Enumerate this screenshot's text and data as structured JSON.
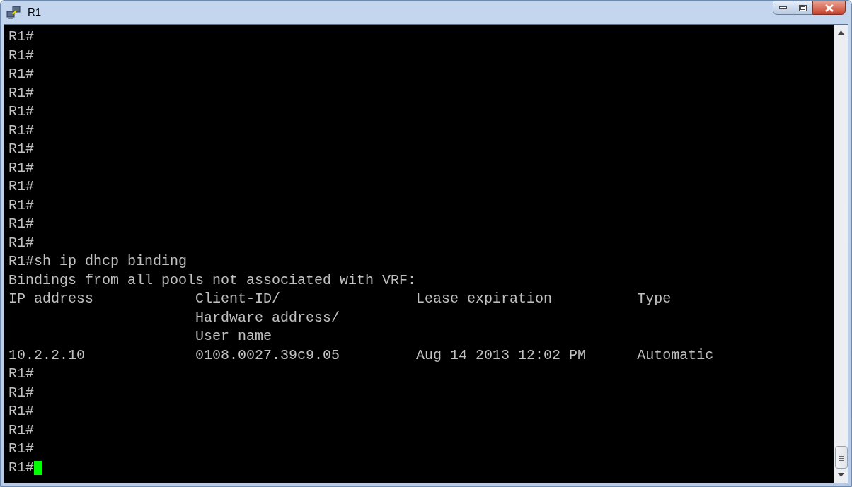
{
  "window": {
    "title": "R1"
  },
  "terminal": {
    "lines": [
      {
        "kind": "text",
        "text": "R1#",
        "cursor": false
      },
      {
        "kind": "text",
        "text": "R1#",
        "cursor": false
      },
      {
        "kind": "text",
        "text": "R1#",
        "cursor": false
      },
      {
        "kind": "text",
        "text": "R1#",
        "cursor": false
      },
      {
        "kind": "text",
        "text": "R1#",
        "cursor": false
      },
      {
        "kind": "text",
        "text": "R1#",
        "cursor": false
      },
      {
        "kind": "text",
        "text": "R1#",
        "cursor": false
      },
      {
        "kind": "text",
        "text": "R1#",
        "cursor": false
      },
      {
        "kind": "text",
        "text": "R1#",
        "cursor": false
      },
      {
        "kind": "text",
        "text": "R1#",
        "cursor": false
      },
      {
        "kind": "text",
        "text": "R1#",
        "cursor": false
      },
      {
        "kind": "text",
        "text": "R1#",
        "cursor": false
      },
      {
        "kind": "text",
        "text": "R1#sh ip dhcp binding",
        "cursor": false
      },
      {
        "kind": "text",
        "text": "Bindings from all pools not associated with VRF:",
        "cursor": false
      },
      {
        "kind": "columns",
        "columns": [
          "IP address",
          "Client-ID/",
          "Lease expiration",
          "Type"
        ]
      },
      {
        "kind": "columns",
        "columns": [
          "",
          "Hardware address/",
          "",
          ""
        ]
      },
      {
        "kind": "columns",
        "columns": [
          "",
          "User name",
          "",
          ""
        ]
      },
      {
        "kind": "columns",
        "columns": [
          "10.2.2.10",
          "0108.0027.39c9.05",
          "Aug 14 2013 12:02 PM",
          "Automatic"
        ]
      },
      {
        "kind": "text",
        "text": "R1#",
        "cursor": false
      },
      {
        "kind": "text",
        "text": "R1#",
        "cursor": false
      },
      {
        "kind": "text",
        "text": "R1#",
        "cursor": false
      },
      {
        "kind": "text",
        "text": "R1#",
        "cursor": false
      },
      {
        "kind": "text",
        "text": "R1#",
        "cursor": false
      },
      {
        "kind": "text",
        "text": "R1#",
        "cursor": true
      }
    ]
  }
}
